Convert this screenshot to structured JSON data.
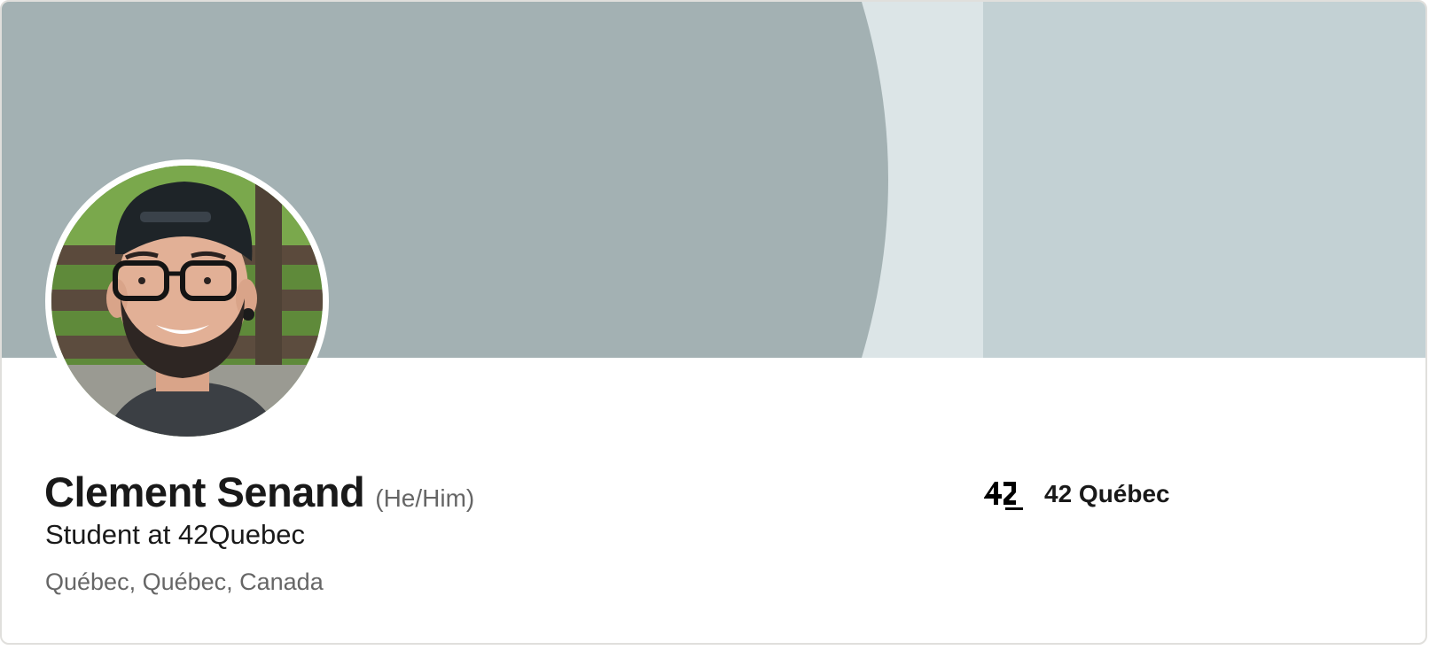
{
  "profile": {
    "name": "Clement Senand",
    "pronouns": "(He/Him)",
    "headline": "Student at 42Quebec",
    "location": "Québec, Québec, Canada"
  },
  "company": {
    "name": "42 Québec",
    "logo_icon": "42-quebec-logo"
  },
  "colors": {
    "banner_left": "#a3b1b3",
    "banner_middle": "#dce5e7",
    "banner_right": "#c3d1d4",
    "name_text": "#191919",
    "secondary_text": "#666666"
  }
}
